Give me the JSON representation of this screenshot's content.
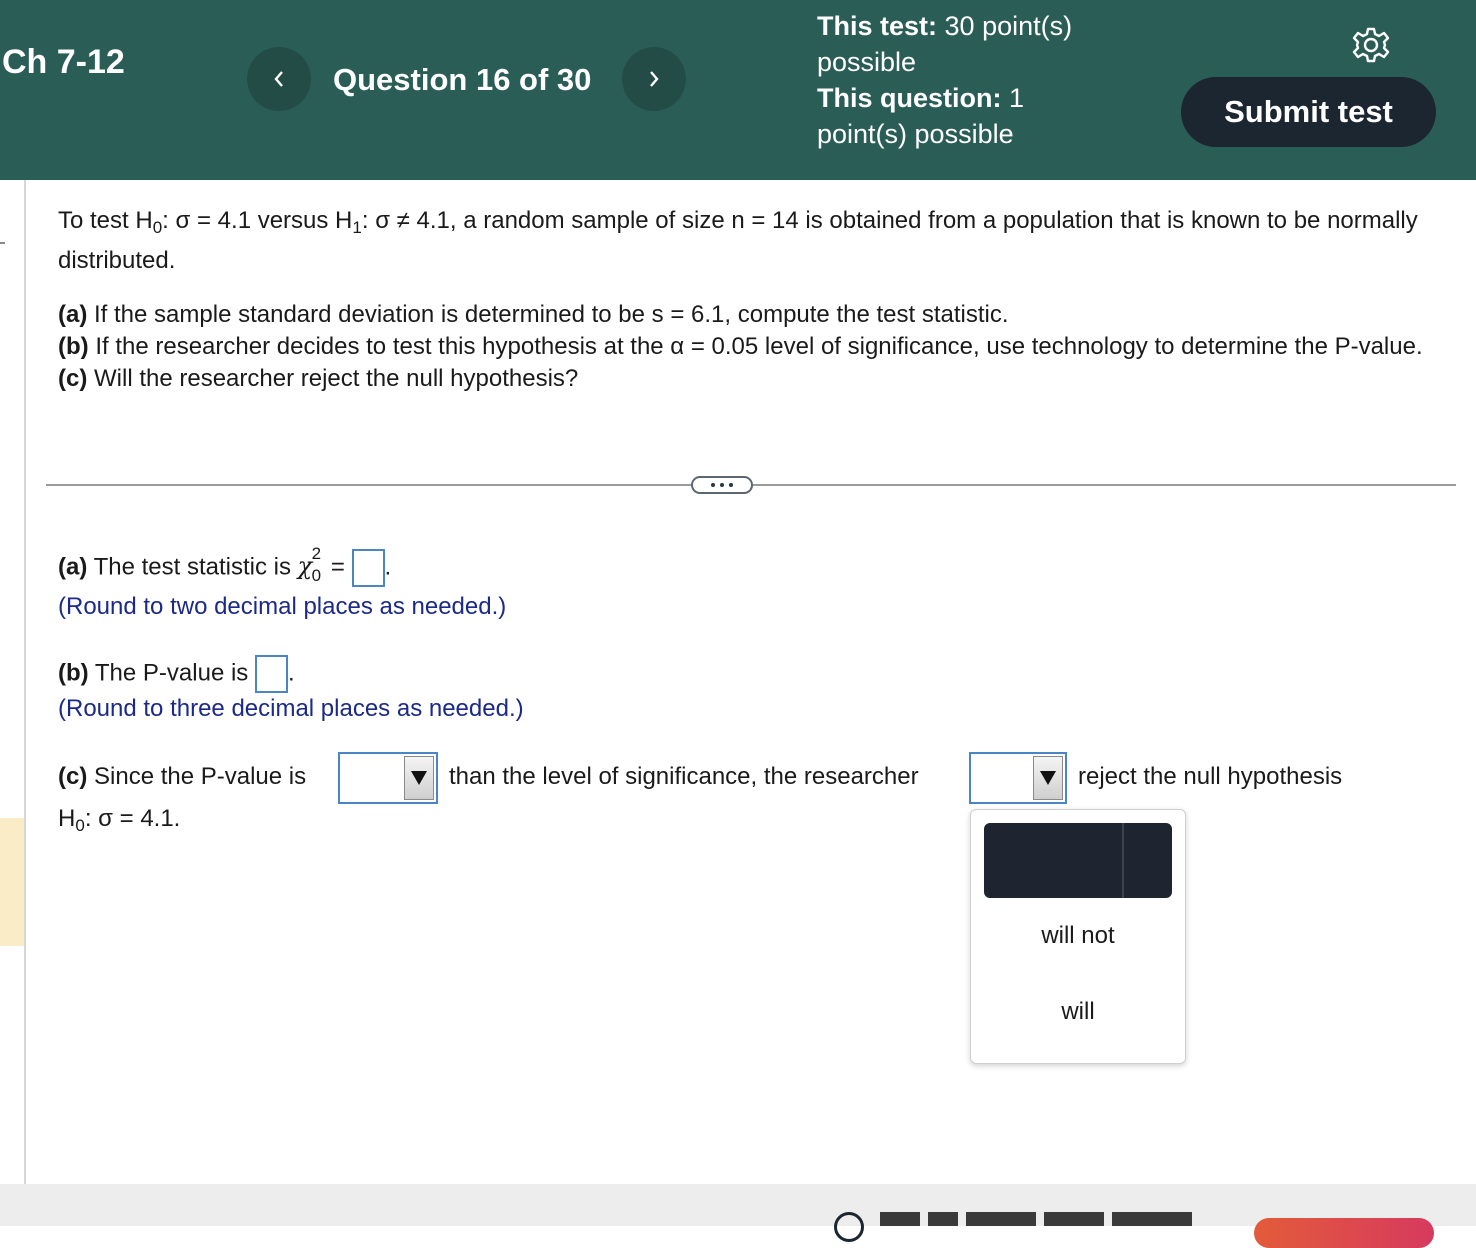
{
  "header": {
    "chapter_title": "Ch 7-12",
    "question_counter": "Question 16 of 30",
    "test_points_label": "This test:",
    "test_points_value": "30 point(s) possible",
    "question_points_label": "This question:",
    "question_points_value": "1 point(s) possible",
    "submit_label": "Submit test",
    "colors": {
      "header_bg": "#2b5d57",
      "submit_bg": "#1c2630"
    }
  },
  "question": {
    "intro_pre": "To test H",
    "h0_sub": "0",
    "intro_mid": ": σ = 4.1 versus H",
    "h1_sub": "1",
    "intro_post": ": σ ≠ 4.1, a random sample of size n = 14 is obtained from a population that is known to be normally distributed.",
    "part_a_tag": "(a)",
    "part_a_text": " If the sample standard deviation is determined to be s = 6.1, compute the test statistic.",
    "part_b_tag": "(b)",
    "part_b_text": " If the researcher decides to test this hypothesis at the α = 0.05 level of significance, use  technology to determine the P-value.",
    "part_c_tag": "(c)",
    "part_c_text": " Will the researcher reject the null hypothesis?"
  },
  "answers": {
    "a_tag": "(a)",
    "a_text": " The test statistic is ",
    "a_chi": "χ",
    "a_chi_sup": "2",
    "a_chi_sub": "0",
    "a_eq": " = ",
    "a_value": "",
    "a_hint": "(Round to two decimal places as needed.)",
    "b_tag": "(b)",
    "b_text": " The P-value is ",
    "b_value": "",
    "b_hint": "(Round to three decimal places as needed.)",
    "c_tag": "(c)",
    "c_text1": " Since the P-value is",
    "c_select1_value": "",
    "c_text2": "than the level of significance, the researcher",
    "c_select2_value": "",
    "c_text3": "reject the null hypothesis",
    "c_line2_pre": "H",
    "c_line2_sub": "0",
    "c_line2_post": ": σ = 4.1."
  },
  "dropdown": {
    "options": [
      "",
      "will not",
      "will"
    ],
    "highlighted_index": 0
  },
  "icons": {
    "prev": "chevron-left-icon",
    "next": "chevron-right-icon",
    "settings": "gear-icon",
    "more": "more-dots-icon"
  }
}
